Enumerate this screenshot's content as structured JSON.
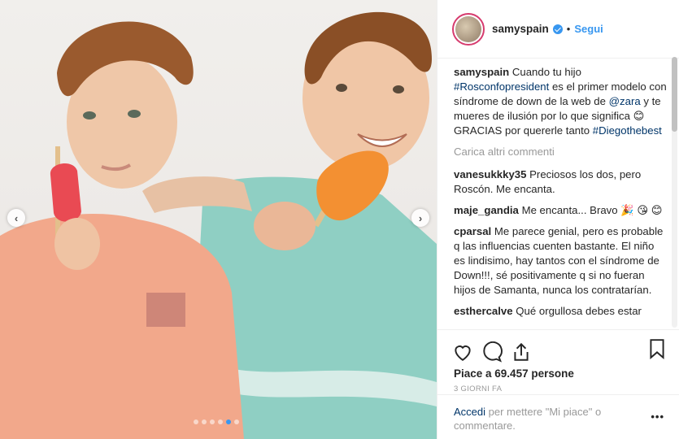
{
  "post_image": {
    "description_icon": "photo",
    "carousel": {
      "total_dots": 6,
      "active_index": 4
    }
  },
  "header": {
    "username": "samyspain",
    "separator": "•",
    "follow_label": "Segui"
  },
  "caption": {
    "author": "samyspain",
    "text_1": "Cuando tu hijo",
    "hashtag_1": "#Rosconfopresident",
    "text_2": "es el primer modelo con síndrome de down de la web de",
    "mention": "@zara",
    "text_3": "y te mueres de ilusión por lo que significa 😊 GRACIAS por quererle tanto",
    "hashtag_2": "#Diegothebest"
  },
  "load_more_label": "Carica altri commenti",
  "comments": [
    {
      "user": "vanesukkky35",
      "text": "Preciosos los dos, pero Roscón. Me encanta."
    },
    {
      "user": "maje_gandia",
      "text": "Me encanta... Bravo 🎉 😘 😊"
    },
    {
      "user": "cparsal",
      "text": "Me parece genial, pero es probable q las influencias cuenten bastante. El niño es lindisimo, hay tantos con el síndrome de Down!!!, sé positivamente q si no fueran hijos de Samanta, nunca los contratarían."
    },
    {
      "user": "esthercalve",
      "text": "Qué orgullosa debes estar"
    }
  ],
  "likes_label": "Piace a 69.457 persone",
  "date_label": "3 GIORNI FA",
  "login": {
    "link_label": "Accedi",
    "text": "per mettere \"Mi piace\" o commentare.",
    "menu": "•••"
  },
  "colors": {
    "accent": "#3897f0",
    "link": "#003569",
    "muted": "#999999"
  }
}
